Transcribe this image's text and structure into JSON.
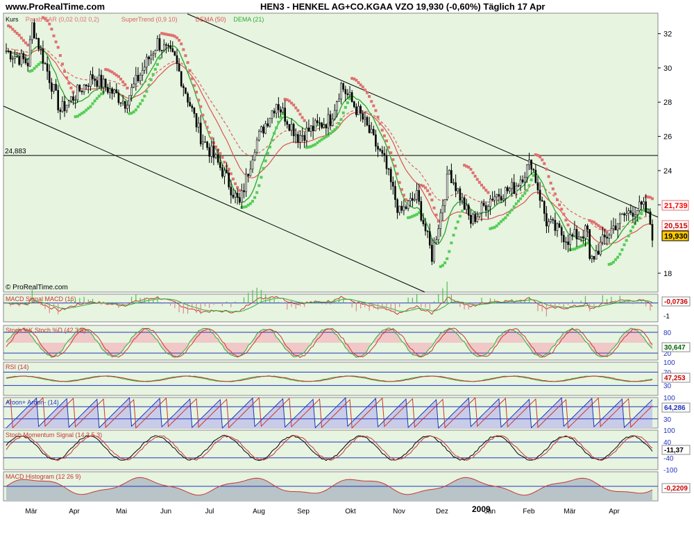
{
  "header": {
    "site": "www.ProRealTime.com",
    "symbol_line": "HEN3 - HENKEL AG+CO.KGAA VZO     19,930 (-0,60%)     Täglich  17 Apr"
  },
  "copyright": "© ProRealTime.com",
  "colors": {
    "panel_bg": "#e6f4e0",
    "candle": "#000000",
    "sar": "#e07070",
    "supertrend": "#e06060",
    "dema50": "#e05050",
    "dema21": "#33aa33",
    "sar_green": "#55cc55",
    "blue_ref": "#2233bb",
    "hist_fill": "#b8c4c8"
  },
  "price_panel": {
    "legend": [
      "Kurs",
      "Parab SAR (0,02 0,02 0,2)",
      "SuperTrend (0,9 10)",
      "DEMA (50)",
      "DEMA (21)"
    ],
    "hline_label": "24,883",
    "y_ticks": [
      "32",
      "30",
      "28",
      "26",
      "24",
      "22",
      "18"
    ],
    "value_tags": [
      "21,739",
      "20,515",
      "19,930"
    ]
  },
  "macd_panel": {
    "legend": "MACD Signal MACD (16)",
    "y_tick": "-1",
    "value_tag": "-0,0736"
  },
  "stoch_panel": {
    "legend": "Stoch %K Stoch %D (42 3 5)",
    "levels": [
      "80",
      "20"
    ],
    "value_tag": "30,647"
  },
  "rsi_panel": {
    "legend": "RSI (14)",
    "levels": [
      "100",
      "70",
      "30"
    ],
    "value_tag": "47,253"
  },
  "aroon_panel": {
    "legend": "Aroon+ Aroon- (14)",
    "levels": [
      "100",
      "70",
      "30"
    ],
    "value_tag": "64,286"
  },
  "stochmom_panel": {
    "legend": "Stoch Momentum Signal (14 3 5 3)",
    "levels": [
      "100",
      "40",
      "-40",
      "-100"
    ],
    "value_tag": "-11,37"
  },
  "hist_panel": {
    "legend": "MACD Histogram (12 26 9)",
    "value_tag": "-0,2209"
  },
  "x_labels": [
    "Mär",
    "Apr",
    "Mai",
    "Jun",
    "Jul",
    "Aug",
    "Sep",
    "Okt",
    "Nov",
    "Dez",
    "2009",
    "Jan",
    "Feb",
    "Mär",
    "Apr"
  ],
  "chart_data": {
    "type": "line",
    "title": "HEN3 - HENKEL AG+CO.KGAA VZO",
    "x": [
      "Mär",
      "Apr",
      "Mai",
      "Jun",
      "Jul",
      "Aug",
      "Sep",
      "Okt",
      "Nov",
      "Dez",
      "Jan",
      "Feb",
      "Mär",
      "Apr"
    ],
    "series": [
      {
        "name": "Kurs",
        "values": [
          31.0,
          28.0,
          29.0,
          31.0,
          24.5,
          27.5,
          26.5,
          28.5,
          20.0,
          22.0,
          23.5,
          19.5,
          18.5,
          21.5
        ]
      }
    ],
    "last_price": 19.93,
    "change": "-0,60%",
    "ylim": [
      17,
      33
    ],
    "grid": false
  }
}
